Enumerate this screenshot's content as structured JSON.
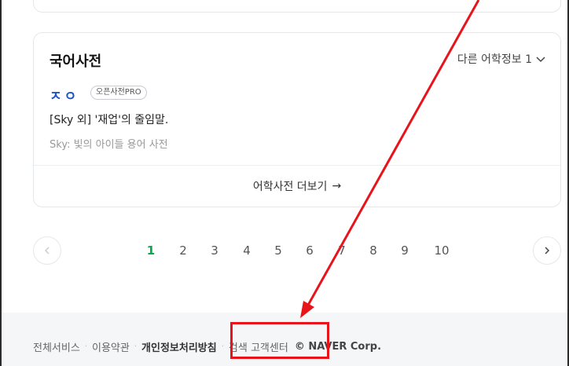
{
  "dictionary": {
    "title": "국어사전",
    "more_info": "다른 어학정보 1",
    "entry": {
      "word": "ㅈㅇ",
      "badge": "오픈사전PRO",
      "definition": "[Sky 외] '재업'의 줄임말.",
      "source": "Sky: 빛의 아이들 용어 사전"
    },
    "more_link": "어학사전 더보기",
    "more_link_arrow": "→"
  },
  "pagination": {
    "pages": [
      "1",
      "2",
      "3",
      "4",
      "5",
      "6",
      "7",
      "8",
      "9",
      "10"
    ],
    "current": "1"
  },
  "footer": {
    "links": [
      "전체서비스",
      "이용약관",
      "개인정보처리방침",
      "검색 고객센터"
    ],
    "copyright": "© NAVER Corp."
  },
  "annotation": {
    "arrow_color": "#e8141c",
    "box_color": "#e8141c"
  }
}
